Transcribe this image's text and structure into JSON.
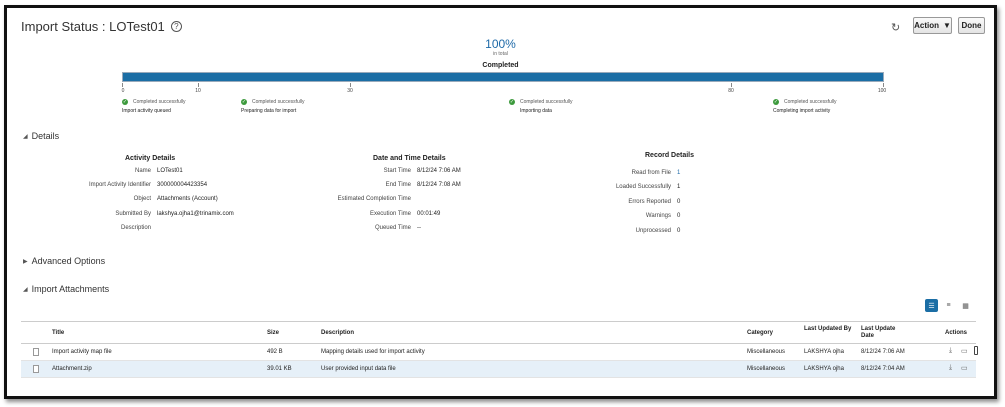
{
  "header": {
    "title": "Import Status : LOTest01",
    "action_label": "Action",
    "done_label": "Done"
  },
  "progress": {
    "percent_text": "100%",
    "percent_value": 100,
    "sub_text": "in total",
    "status": "Completed",
    "ticks": [
      "0",
      "10",
      "30",
      "80",
      "100"
    ],
    "steps": [
      {
        "status": "Completed successfully",
        "label": "Import activity queued"
      },
      {
        "status": "Completed successfully",
        "label": "Preparing data for import"
      },
      {
        "status": "Completed successfully",
        "label": "Importing data"
      },
      {
        "status": "Completed successfully",
        "label": "Completing import activity"
      }
    ]
  },
  "details": {
    "section_label": "Details",
    "activity": {
      "heading": "Activity Details",
      "rows": [
        {
          "k": "Name",
          "v": "LOTest01"
        },
        {
          "k": "Import Activity Identifier",
          "v": "300000004423354"
        },
        {
          "k": "Object",
          "v": "Attachments (Account)"
        },
        {
          "k": "Submitted By",
          "v": "lakshya.ojha1@trinamix.com"
        },
        {
          "k": "Description",
          "v": ""
        }
      ]
    },
    "datetime": {
      "heading": "Date and Time Details",
      "rows": [
        {
          "k": "Start Time",
          "v": "8/12/24 7:06 AM"
        },
        {
          "k": "End Time",
          "v": "8/12/24 7:08 AM"
        },
        {
          "k": "Estimated Completion Time",
          "v": ""
        },
        {
          "k": "Execution Time",
          "v": "00:01:49"
        },
        {
          "k": "Queued Time",
          "v": "--"
        }
      ]
    },
    "record": {
      "heading": "Record Details",
      "rows": [
        {
          "k": "Read from File",
          "v": "1"
        },
        {
          "k": "Loaded Successfully",
          "v": "1"
        },
        {
          "k": "Errors Reported",
          "v": "0"
        },
        {
          "k": "Warnings",
          "v": "0"
        },
        {
          "k": "Unprocessed",
          "v": "0"
        }
      ]
    }
  },
  "advanced": {
    "section_label": "Advanced Options"
  },
  "attachments": {
    "section_label": "Import Attachments",
    "columns": {
      "title": "Title",
      "size": "Size",
      "description": "Description",
      "category": "Category",
      "last_updated_by": "Last Updated By",
      "last_update_date": "Last Update Date",
      "actions": "Actions"
    },
    "rows": [
      {
        "title": "Import activity map file",
        "size": "492 B",
        "description": "Mapping details used for import activity",
        "category": "Miscellaneous",
        "by": "LAKSHYA ojha",
        "date": "8/12/24 7:06 AM"
      },
      {
        "title": "Attachment.zip",
        "size": "39.01 KB",
        "description": "User provided input data file",
        "category": "Miscellaneous",
        "by": "LAKSHYA ojha",
        "date": "8/12/24 7:04 AM"
      }
    ]
  },
  "colors": {
    "accent": "#1b6ea5",
    "success": "#3c9a3c",
    "selected_row": "#e6f0f8"
  }
}
